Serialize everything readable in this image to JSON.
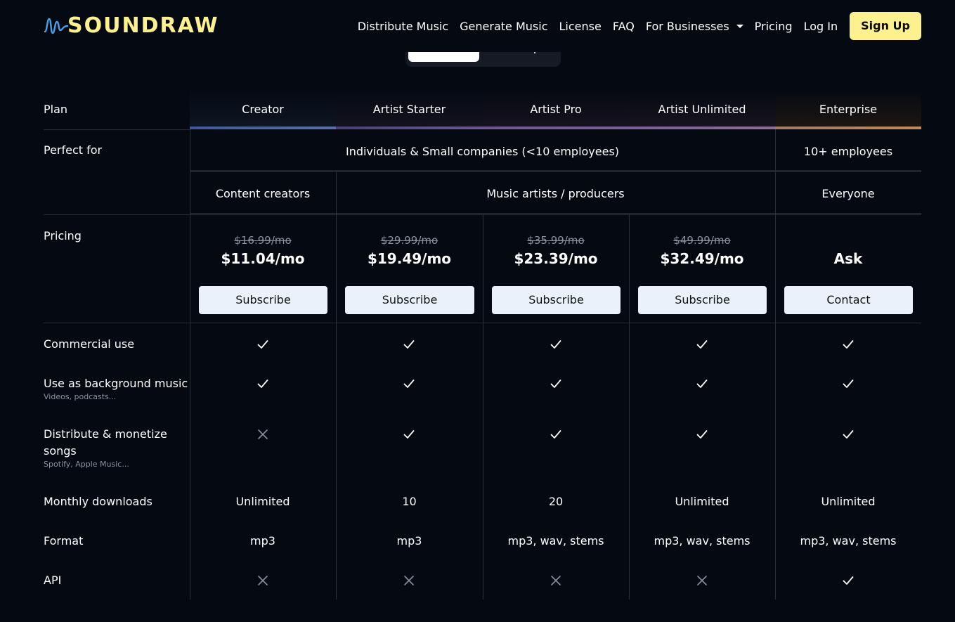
{
  "brand": {
    "name": "SOUNDRAW"
  },
  "nav": {
    "items": [
      "Distribute Music",
      "Generate Music",
      "License",
      "FAQ",
      "For Businesses",
      "Pricing",
      "Log In"
    ],
    "signup": "Sign Up"
  },
  "table": {
    "row_labels": {
      "plan": "Plan",
      "perfect_for": "Perfect for",
      "pricing": "Pricing",
      "commercial": "Commercial use",
      "background": "Use as background music",
      "background_sub": "Videos, podcasts...",
      "distribute_line1": "Distribute & monetize",
      "distribute_line2": "songs",
      "distribute_sub": "Spotify, Apple Music...",
      "downloads": "Monthly downloads",
      "format": "Format",
      "api": "API"
    },
    "plans": [
      {
        "name": "Creator",
        "old_price": "$16.99/mo",
        "price": "$11.04/mo",
        "button": "Subscribe",
        "downloads": "Unlimited",
        "format": "mp3",
        "accent": "#4a6aa8"
      },
      {
        "name": "Artist Starter",
        "old_price": "$29.99/mo",
        "price": "$19.49/mo",
        "button": "Subscribe",
        "downloads": "10",
        "format": "mp3",
        "accent": "#6b5a8e"
      },
      {
        "name": "Artist Pro",
        "old_price": "$35.99/mo",
        "price": "$23.39/mo",
        "button": "Subscribe",
        "downloads": "20",
        "format": "mp3, wav, stems",
        "accent": "#7a5e90"
      },
      {
        "name": "Artist Unlimited",
        "old_price": "$49.99/mo",
        "price": "$32.49/mo",
        "button": "Subscribe",
        "downloads": "Unlimited",
        "format": "mp3, wav, stems",
        "accent": "#856a96"
      },
      {
        "name": "Enterprise",
        "old_price": "",
        "price": "Ask",
        "button": "Contact",
        "downloads": "Unlimited",
        "format": "mp3, wav, stems",
        "accent": "#b08058"
      }
    ],
    "perfect_for": {
      "group_small": "Individuals & Small companies (<10 employees)",
      "group_large": "10+ employees",
      "creators": "Content creators",
      "artists": "Music artists / producers",
      "everyone": "Everyone"
    },
    "features": {
      "commercial": [
        "check",
        "check",
        "check",
        "check",
        "check"
      ],
      "background": [
        "check",
        "check",
        "check",
        "check",
        "check"
      ],
      "distribute": [
        "cross",
        "check",
        "check",
        "check",
        "check"
      ],
      "api": [
        "cross",
        "cross",
        "cross",
        "cross",
        "check"
      ]
    }
  }
}
